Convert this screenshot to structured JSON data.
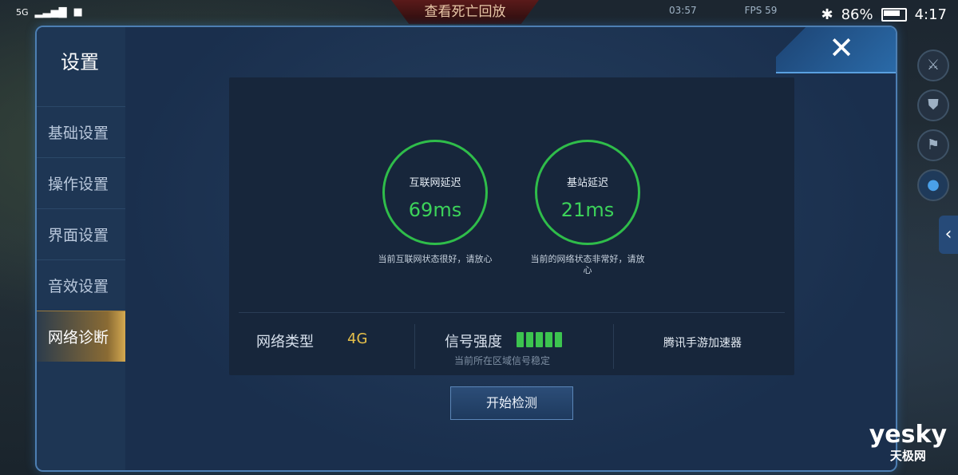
{
  "status_bar": {
    "signal": "5G",
    "percent": "86%",
    "time": "4:17"
  },
  "game_bg": {
    "replay_label": "查看死亡回放",
    "clock": "03:57",
    "fps": "FPS 59"
  },
  "dialog": {
    "title": "设置",
    "nav": [
      {
        "label": "基础设置",
        "active": false
      },
      {
        "label": "操作设置",
        "active": false
      },
      {
        "label": "界面设置",
        "active": false
      },
      {
        "label": "音效设置",
        "active": false
      },
      {
        "label": "网络诊断",
        "active": true
      }
    ],
    "close_glyph": "✕"
  },
  "diagnostics": {
    "internet": {
      "label": "互联网延迟",
      "value": "69ms",
      "note": "当前互联网状态很好，请放心"
    },
    "base_station": {
      "label": "基站延迟",
      "value": "21ms",
      "note": "当前的网络状态非常好，请放心"
    },
    "network_type_label": "网络类型",
    "network_type_value": "4G",
    "signal_label": "信号强度",
    "signal_bars_filled": 5,
    "signal_bars_total": 5,
    "signal_note": "当前所在区域信号稳定",
    "accelerator_label": "腾讯手游加速器"
  },
  "start_button": "开始检测",
  "watermark": {
    "brand": "yesky",
    "cn": "天极网"
  },
  "colors": {
    "gauge_green": "#2fbd4a",
    "network_value_yellow": "#e6c04a",
    "active_nav_gold": "#d4a950"
  },
  "icons": [
    "sword-icon",
    "shield-icon",
    "flag-icon",
    "chat-icon",
    "chevron-left-icon",
    "close-icon"
  ]
}
